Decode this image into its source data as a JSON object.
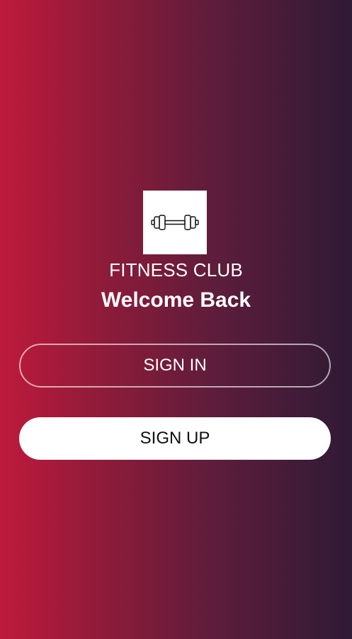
{
  "brand": {
    "logo_icon": "dumbbell-icon",
    "name": "FITNESS CLUB",
    "tagline": "Welcome Back"
  },
  "actions": {
    "sign_in_label": "SIGN IN",
    "sign_up_label": "SIGN UP"
  },
  "colors": {
    "gradient_left": "#bf1a3b",
    "gradient_right": "#2f1a35",
    "button_fill": "#ffffff"
  }
}
